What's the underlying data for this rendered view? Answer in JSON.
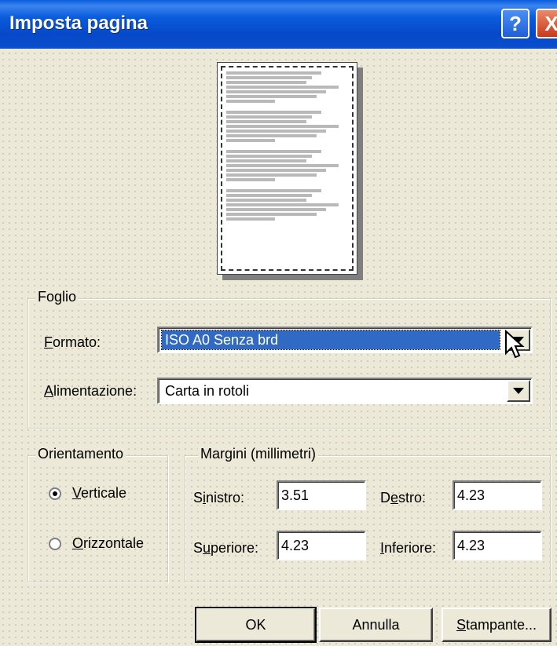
{
  "window": {
    "title": "Imposta pagina",
    "help_glyph": "?",
    "close_glyph": "X"
  },
  "preview": {
    "line_groups": 4,
    "lines_per_group": 7
  },
  "paper": {
    "group_label": "Foglio",
    "format_label": "Formato:",
    "format_value": "ISO A0 Senza brd",
    "source_label": "Alimentazione:",
    "source_value": "Carta in rotoli"
  },
  "orientation": {
    "group_label": "Orientamento",
    "portrait_label": "Verticale",
    "landscape_label": "Orizzontale",
    "selected": "portrait"
  },
  "margins": {
    "group_label": "Margini (millimetri)",
    "left_label": "Sinistro:",
    "left_value": "3.51",
    "right_label": "Destro:",
    "right_value": "4.23",
    "top_label": "Superiore:",
    "top_value": "4.23",
    "bottom_label": "Inferiore:",
    "bottom_value": "4.23"
  },
  "buttons": {
    "ok": "OK",
    "cancel": "Annulla",
    "printer": "Stampante..."
  },
  "colors": {
    "title_bar": "#0a5ddd",
    "selection": "#316ac5",
    "dialog_bg": "#ece9d8"
  }
}
